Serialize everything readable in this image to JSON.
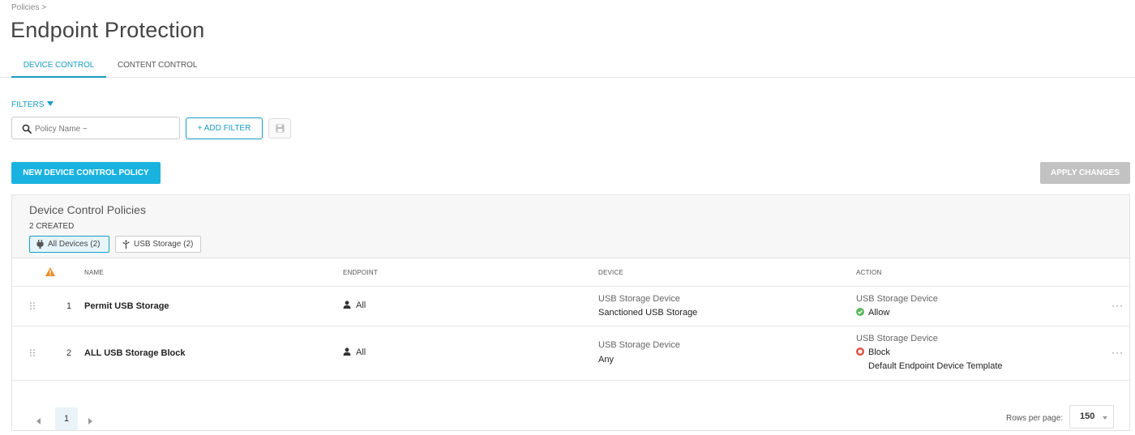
{
  "breadcrumb": "Policies >",
  "page_title": "Endpoint Protection",
  "tabs": [
    {
      "label": "DEVICE CONTROL",
      "active": true
    },
    {
      "label": "CONTENT CONTROL",
      "active": false
    }
  ],
  "filters": {
    "toggle_label": "FILTERS",
    "search_placeholder": "Policy Name ~",
    "add_filter_label": "+ ADD FILTER"
  },
  "actions": {
    "new_policy_label": "NEW DEVICE CONTROL POLICY",
    "apply_changes_label": "APPLY CHANGES"
  },
  "panel": {
    "title": "Device Control Policies",
    "count_label": "2 CREATED",
    "chips": [
      {
        "label": "All Devices (2)",
        "selected": true,
        "icon": "plug-icon"
      },
      {
        "label": "USB Storage (2)",
        "selected": false,
        "icon": "usb-icon"
      }
    ]
  },
  "table": {
    "columns": [
      "NAME",
      "ENDPOINT",
      "DEVICE",
      "ACTION"
    ],
    "rows": [
      {
        "index": "1",
        "name": "Permit USB Storage",
        "endpoint": "All",
        "device_type": "USB Storage Device",
        "device_name": "Sanctioned USB Storage",
        "action_type": "USB Storage Device",
        "action": "Allow",
        "action_status": "allow",
        "action_template": ""
      },
      {
        "index": "2",
        "name": "ALL USB Storage Block",
        "endpoint": "All",
        "device_type": "USB Storage Device",
        "device_name": "Any",
        "action_type": "USB Storage Device",
        "action": "Block",
        "action_status": "block",
        "action_template": "Default Endpoint Device Template"
      }
    ],
    "more_label": "···"
  },
  "pagination": {
    "current_page": "1",
    "rows_per_page_label": "Rows per page:",
    "rows_per_page_value": "150"
  },
  "colors": {
    "accent": "#1a9cc4",
    "primary_button": "#1ab3e0",
    "disabled_button": "#c2c2c2",
    "warning": "#f08a24",
    "allow": "#5cb85c",
    "block": "#e24c3a"
  }
}
